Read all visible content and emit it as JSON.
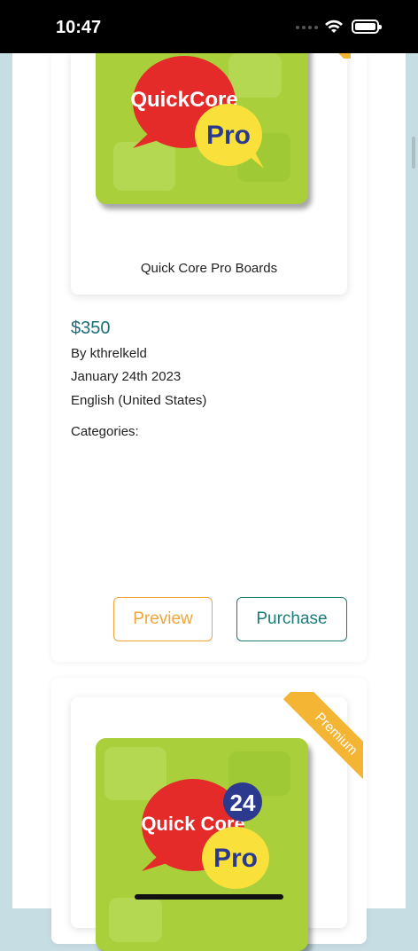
{
  "status": {
    "time": "10:47"
  },
  "listing1": {
    "title": "Quick Core Pro Boards",
    "logo_main": "QuickCore",
    "logo_sub": "Pro",
    "price": "$350",
    "author": "By kthrelkeld",
    "date": "January 24th 2023",
    "language": "English (United States)",
    "categories_label": "Categories:",
    "preview_label": "Preview",
    "purchase_label": "Purchase"
  },
  "listing2": {
    "badge": "Premium",
    "logo_main": "Quick Core",
    "logo_sub": "Pro",
    "logo_badge": "24"
  },
  "colors": {
    "accent": "#1d6f7a",
    "preview": "#f0a53a",
    "premium": "#f3b533",
    "tile": "#a9cf3b"
  }
}
